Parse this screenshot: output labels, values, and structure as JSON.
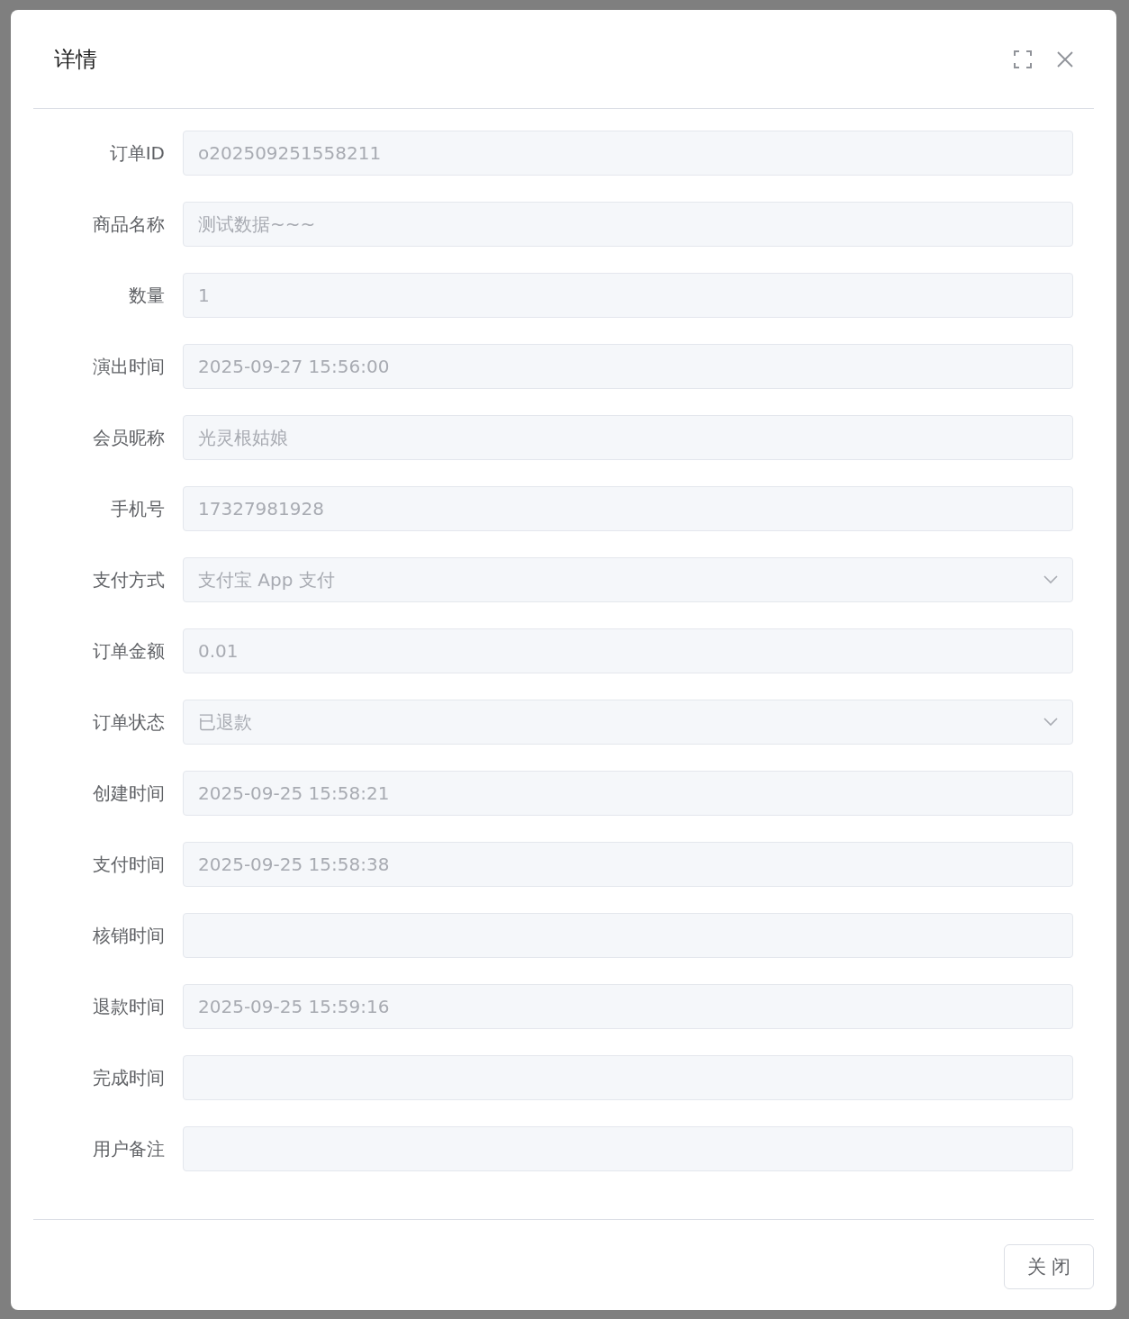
{
  "dialog": {
    "title": "详情",
    "fields": [
      {
        "label": "订单ID",
        "kind": "input",
        "value": "o202509251558211"
      },
      {
        "label": "商品名称",
        "kind": "input",
        "value": "测试数据~~~"
      },
      {
        "label": "数量",
        "kind": "input",
        "value": "1"
      },
      {
        "label": "演出时间",
        "kind": "input",
        "value": "2025-09-27 15:56:00"
      },
      {
        "label": "会员昵称",
        "kind": "input",
        "value": "光灵根姑娘"
      },
      {
        "label": "手机号",
        "kind": "input",
        "value": "17327981928"
      },
      {
        "label": "支付方式",
        "kind": "select",
        "value": "支付宝 App 支付"
      },
      {
        "label": "订单金额",
        "kind": "input",
        "value": "0.01"
      },
      {
        "label": "订单状态",
        "kind": "select",
        "value": "已退款"
      },
      {
        "label": "创建时间",
        "kind": "input",
        "value": "2025-09-25 15:58:21"
      },
      {
        "label": "支付时间",
        "kind": "input",
        "value": "2025-09-25 15:58:38"
      },
      {
        "label": "核销时间",
        "kind": "input"
      },
      {
        "label": "退款时间",
        "kind": "input",
        "value": "2025-09-25 15:59:16"
      },
      {
        "label": "完成时间",
        "kind": "input"
      },
      {
        "label": "用户备注",
        "kind": "input"
      }
    ],
    "buttons": [
      "关 闭"
    ]
  }
}
